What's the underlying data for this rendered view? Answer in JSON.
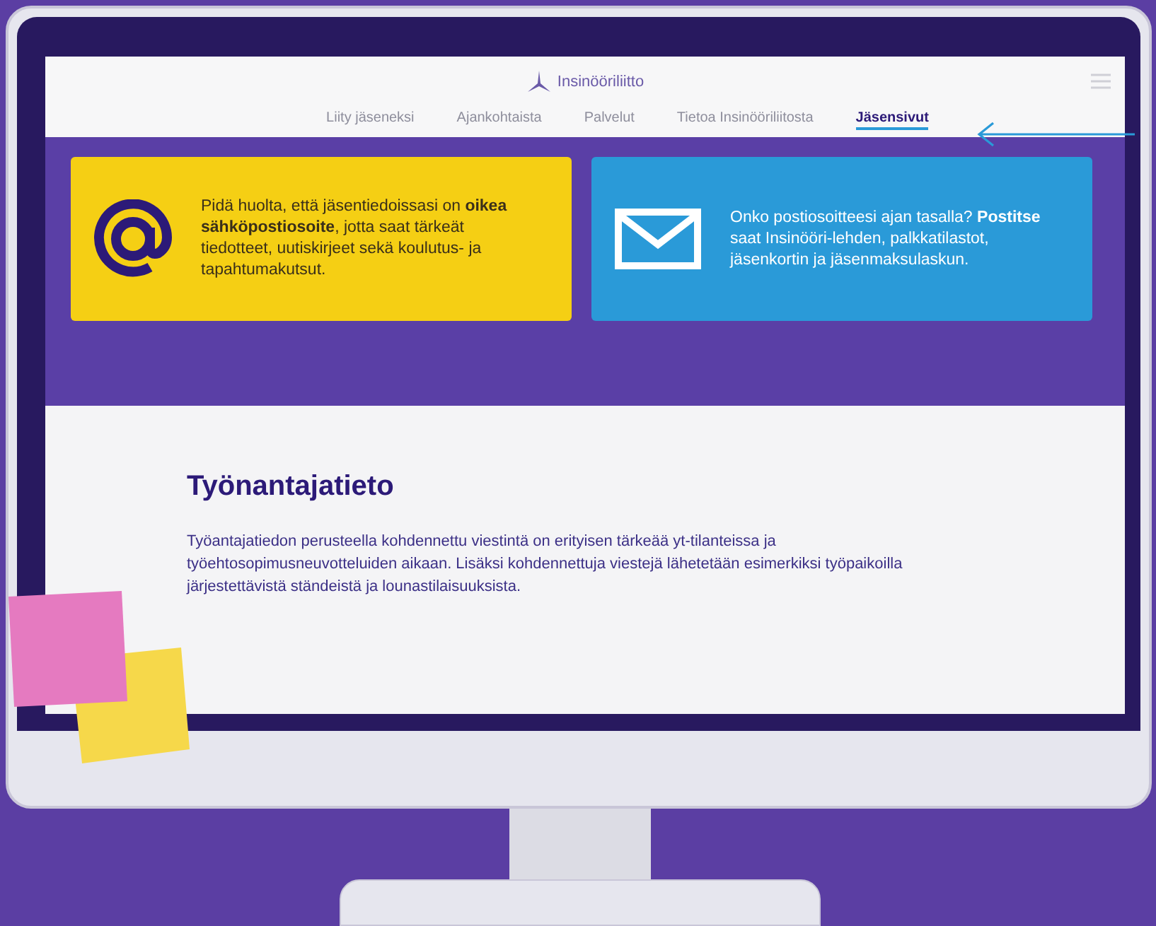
{
  "header": {
    "logo_text": "Insinööriliitto"
  },
  "nav": [
    {
      "label": "Liity jäseneksi",
      "selected": false
    },
    {
      "label": "Ajankohtaista",
      "selected": false
    },
    {
      "label": "Palvelut",
      "selected": false
    },
    {
      "label": "Tietoa Insinööriliitosta",
      "selected": false
    },
    {
      "label": "Jäsensivut",
      "selected": true
    }
  ],
  "cards": [
    {
      "kind": "email",
      "text": "Pidä huolta, että jäsentiedoissasi on **oikea sähköpostiosoite**, jotta saat tärkeät tiedotteet, uutiskirjeet sekä koulutus- ja tapahtumakutsut."
    },
    {
      "kind": "post",
      "text": "Onko postiosoitteesi ajan tasalla? **Postitse** saat Insinööri-lehden, palkkatilastot, jäsenkortin ja jäsenmaksulaskun."
    }
  ],
  "section": {
    "title": "Työnantajatieto",
    "body": "Työantajatiedon perusteella kohdennettu viestintä on erityisen tärkeää yt-tilanteissa ja työehtosopimusneuvotteluiden aikaan. Lisäksi kohdennettuja viestejä lähetetään esimerkiksi työpaikoilla järjestettävistä ständeistä ja lounastilaisuuksista."
  }
}
